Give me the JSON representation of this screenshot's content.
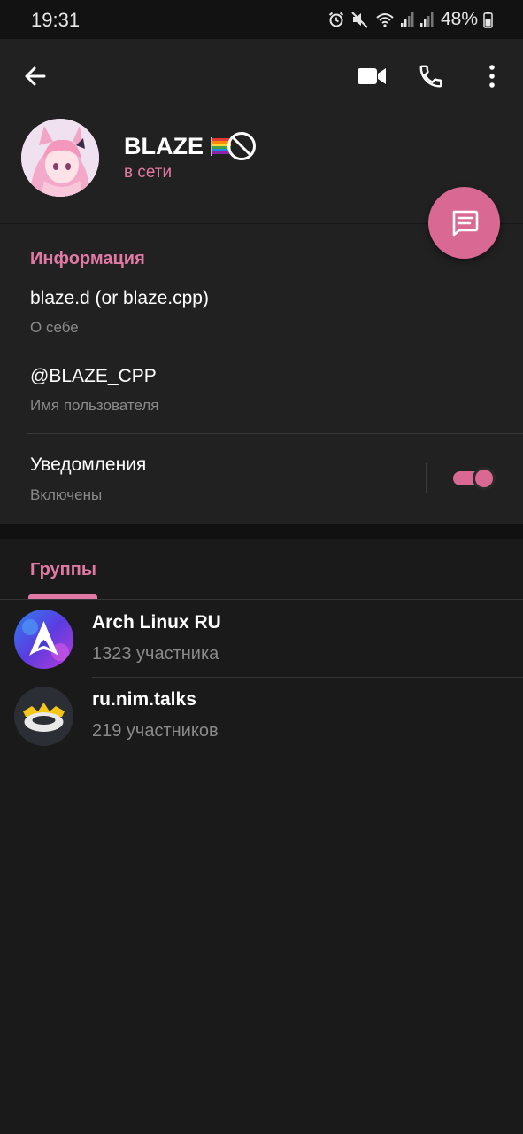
{
  "status_bar": {
    "time": "19:31",
    "battery": "48%",
    "icons": [
      "alarm-icon",
      "mute-icon",
      "wifi-icon",
      "signal-icon",
      "signal-icon",
      "battery-icon"
    ]
  },
  "toolbar": {
    "back_icon": "arrow-left-icon",
    "video_icon": "video-camera-icon",
    "call_icon": "phone-icon",
    "menu_icon": "more-vertical-icon"
  },
  "profile": {
    "name": "BLAZE",
    "name_emoji": [
      "rainbow-flag-icon",
      "prohibited-icon"
    ],
    "status": "в сети",
    "avatar": "anime-avatar"
  },
  "fab": {
    "icon": "message-icon"
  },
  "info": {
    "title": "Информация",
    "bio_value": "blaze.d (or blaze.cpp)",
    "bio_label": "О себе",
    "username_value": "@BLAZE_CPP",
    "username_label": "Имя пользователя",
    "notifications_value": "Уведомления",
    "notifications_label": "Включены",
    "notifications_enabled": true
  },
  "groups": {
    "tab_label": "Группы",
    "items": [
      {
        "name": "Arch Linux RU",
        "count": "1323 участника",
        "avatar": "arch-linux-logo"
      },
      {
        "name": "ru.nim.talks",
        "count": "219 участников",
        "avatar": "nim-crown-logo"
      }
    ]
  },
  "colors": {
    "accent": "#e07aa4",
    "fab": "#d96893",
    "header_bg": "#212121",
    "page_bg": "#1a1a1a"
  }
}
